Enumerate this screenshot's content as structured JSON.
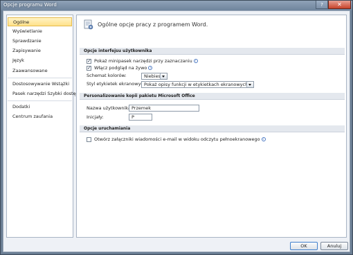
{
  "window": {
    "title": "Opcje programu Word",
    "help_label": "?",
    "close_label": "✕"
  },
  "sidebar": {
    "items": [
      {
        "label": "Ogólne",
        "selected": true
      },
      {
        "label": "Wyświetlanie"
      },
      {
        "label": "Sprawdzanie"
      },
      {
        "label": "Zapisywanie"
      },
      {
        "label": "Język"
      },
      {
        "label": "Zaawansowane"
      },
      {
        "label": "Dostosowywanie Wstążki"
      },
      {
        "label": "Pasek narzędzi Szybki dostęp"
      },
      {
        "label": "Dodatki"
      },
      {
        "label": "Centrum zaufania"
      }
    ]
  },
  "main": {
    "header": "Ogólne opcje pracy z programem Word.",
    "ui_options": {
      "title": "Opcje interfejsu użytkownika",
      "mini_toolbar": {
        "label": "Pokaż minipasek narzędzi przy zaznaczaniu",
        "checked": true
      },
      "live_preview": {
        "label": "Włącz podgląd na żywo",
        "checked": true
      },
      "color_scheme": {
        "label": "Schemat kolorów:",
        "value": "Niebieski"
      },
      "tooltip_style": {
        "label": "Styl etykietek ekranowych:",
        "value": "Pokaż opisy funkcji w etykietkach ekranowych"
      }
    },
    "personalize": {
      "title": "Personalizowanie kopii pakietu Microsoft Office",
      "user_name": {
        "label": "Nazwa użytkownika:",
        "value": "Przemek"
      },
      "initials": {
        "label": "Inicjały:",
        "value": "P"
      }
    },
    "startup": {
      "title": "Opcje uruchamiania",
      "open_attachments": {
        "label": "Otwórz załączniki wiadomości e-mail w widoku odczytu pełnoekranowego",
        "checked": false
      }
    }
  },
  "buttons": {
    "ok": "OK",
    "cancel": "Anuluj"
  },
  "colors": {
    "selected_item": "#ffe18a",
    "section_bg": "#e4e8ee",
    "window_frame": "#6b7e94"
  },
  "icons": [
    "help-icon",
    "close-icon",
    "options-header-icon",
    "info-icon",
    "checkmark-icon",
    "dropdown-arrow-icon"
  ]
}
